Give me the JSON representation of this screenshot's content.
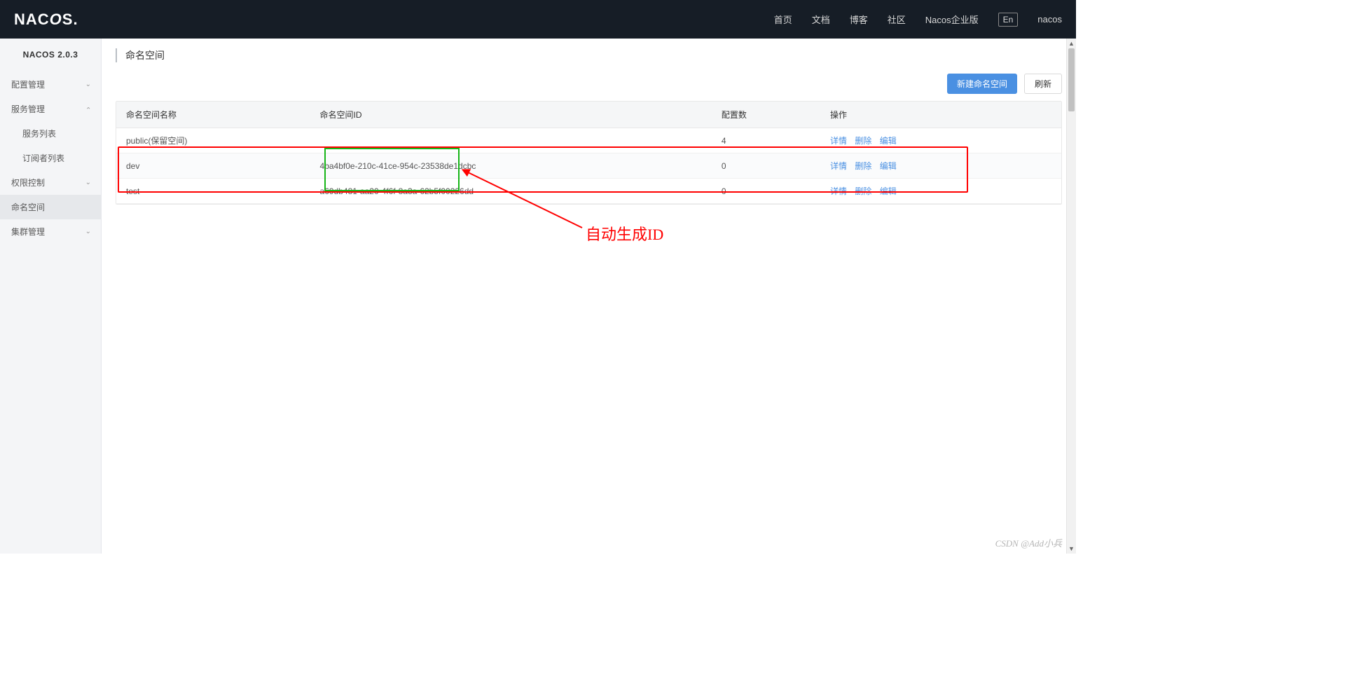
{
  "topbar": {
    "logo_text": "NACOS.",
    "links": [
      "首页",
      "文档",
      "博客",
      "社区",
      "Nacos企业版"
    ],
    "lang": "En",
    "user": "nacos"
  },
  "sidebar": {
    "title": "NACOS 2.0.3",
    "items": [
      {
        "label": "配置管理",
        "expandable": true,
        "expanded": false
      },
      {
        "label": "服务管理",
        "expandable": true,
        "expanded": true,
        "children": [
          "服务列表",
          "订阅者列表"
        ]
      },
      {
        "label": "权限控制",
        "expandable": true,
        "expanded": false
      },
      {
        "label": "命名空间",
        "expandable": false,
        "active": true
      },
      {
        "label": "集群管理",
        "expandable": true,
        "expanded": false
      }
    ]
  },
  "page": {
    "title": "命名空间",
    "create_btn": "新建命名空间",
    "refresh_btn": "刷新"
  },
  "table": {
    "headers": {
      "name": "命名空间名称",
      "id": "命名空间ID",
      "cfg": "配置数",
      "op": "操作"
    },
    "op_labels": {
      "detail": "详情",
      "delete": "删除",
      "edit": "编辑"
    },
    "rows": [
      {
        "name": "public(保留空间)",
        "id": "",
        "cfg": "4"
      },
      {
        "name": "dev",
        "id": "4ba4bf0e-210c-41ce-954c-23538de1dcbc",
        "cfg": "0"
      },
      {
        "name": "test",
        "id": "a69db481-aa20-4f6f-8a3a-62b5f00226dd",
        "cfg": "0"
      }
    ]
  },
  "annotation": {
    "text": "自动生成ID"
  },
  "watermark": "CSDN @Add小兵"
}
